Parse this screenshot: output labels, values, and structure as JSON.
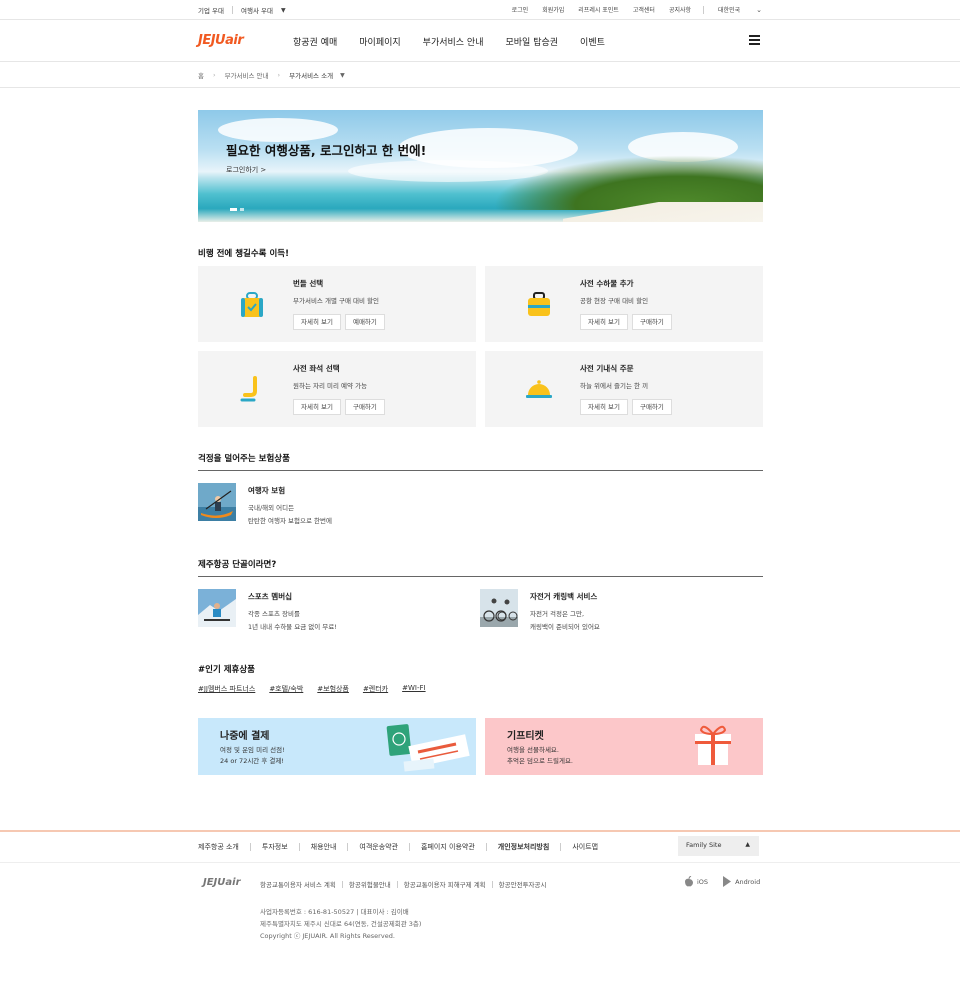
{
  "util": {
    "left": [
      "기업 우대",
      "여행사 우대"
    ],
    "right": [
      "로그인",
      "회원가입",
      "리프레시 포인트",
      "고객센터",
      "공지사항"
    ],
    "region": "대한민국"
  },
  "header": {
    "logo": "JEJUair",
    "nav": [
      "항공권 예매",
      "마이페이지",
      "부가서비스 안내",
      "모바일 탑승권",
      "이벤트"
    ]
  },
  "breadcrumb": [
    "홈",
    "부가서비스 안내",
    "부가서비스 소개"
  ],
  "banner": {
    "title": "필요한 여행상품, 로그인하고 한 번에!",
    "link": "로그인하기 >"
  },
  "services": {
    "title": "비행 전에 챙길수록 이득!",
    "cards": [
      {
        "icon": "backpack-icon",
        "title": "번들 선택",
        "desc": "부가서비스 개별 구매 대비 할인",
        "btn1": "자세히 보기",
        "btn2": "예매하기"
      },
      {
        "icon": "baggage-icon",
        "title": "사전 수하물 추가",
        "desc": "공항 현장 구매 대비 할인",
        "btn1": "자세히 보기",
        "btn2": "구매하기"
      },
      {
        "icon": "seat-icon",
        "title": "사전 좌석 선택",
        "desc": "원하는 자리 미리 예약 가능",
        "btn1": "자세히 보기",
        "btn2": "구매하기"
      },
      {
        "icon": "meal-cloche-icon",
        "title": "사전 기내식 주문",
        "desc": "하늘 위에서 즐기는 한 끼",
        "btn1": "자세히 보기",
        "btn2": "구매하기"
      }
    ]
  },
  "insurance": {
    "title": "걱정을 덜어주는 보험상품",
    "item": {
      "title": "여행자 보험",
      "desc1": "국내/해외 어디든",
      "desc2": "탄탄한 여행자 보험으로 한번에"
    }
  },
  "regular": {
    "title": "제주항공 단골이라면?",
    "items": [
      {
        "title": "스포츠 멤버십",
        "desc1": "각종 스포츠 장비를",
        "desc2": "1년 내내 수하물 요금 없이 무료!"
      },
      {
        "title": "자전거 캐링백 서비스",
        "desc1": "자전거 걱정은 그만,",
        "desc2": "캐링백이 준비되어 있어요"
      }
    ]
  },
  "partners": {
    "title": "#인기 제휴상품",
    "tags": [
      "#JJ멤버스 파트너스",
      "#호텔/숙박",
      "#보험상품",
      "#렌터카",
      "#WI-FI"
    ]
  },
  "promos": [
    {
      "title": "나중에 결제",
      "desc1": "여정 및 운임 미리 선점!",
      "desc2": "24 or 72시간 후 결제!",
      "bg": "#c8e8fb"
    },
    {
      "title": "기프티켓",
      "desc1": "여행을 선물하세요.",
      "desc2": "추억은 덤으로 드릴게요.",
      "bg": "#fcc7c9"
    }
  ],
  "footer": {
    "nav": [
      "제주항공 소개",
      "투자정보",
      "채용안내",
      "여객운송약관",
      "홈페이지 이용약관",
      "개인정보처리방침",
      "사이트맵"
    ],
    "family": "Family Site",
    "logo": "JEJUair",
    "links": [
      "항공교통이용자 서비스 계획",
      "항공위험물안내",
      "항공교통이용자 피해구제 계획",
      "항공안전투자공시"
    ],
    "apps": [
      "iOS",
      "Android"
    ],
    "info1": "사업자등록번호 : 616-81-50527  |  대표이사 : 김이배",
    "info2": "제주특별자치도 제주시 신대로 64(연동, 건설공제회관 3층)",
    "copyright": "Copyright ⓒ JEJUAIR. All Rights Reserved."
  },
  "colors": {
    "brand": "#f15a22",
    "icon_yellow": "#f9c21b",
    "icon_teal": "#2aa7c6"
  }
}
